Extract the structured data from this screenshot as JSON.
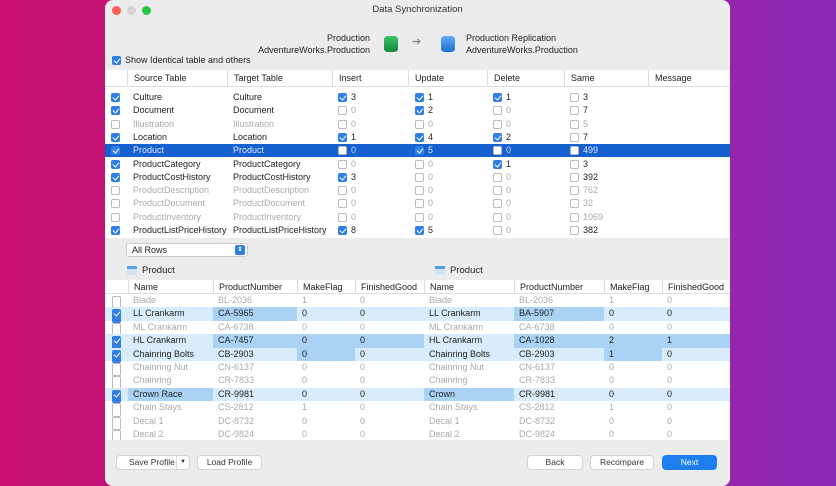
{
  "window": {
    "title": "Data Synchronization"
  },
  "source": {
    "name": "Production",
    "db": "AdventureWorks.Production",
    "color": "#1f9e4a"
  },
  "target": {
    "name": "Production Replication",
    "db": "AdventureWorks.Production",
    "color": "#2b86e0"
  },
  "show_identical": {
    "label": "Show Identical table and others",
    "checked": true
  },
  "top_table": {
    "columns": [
      "Source Table",
      "Target Table",
      "Insert",
      "Update",
      "Delete",
      "Same",
      "Message"
    ],
    "rows": [
      {
        "checked": true,
        "source": "Culture",
        "target": "Culture",
        "insert": [
          true,
          "3"
        ],
        "update": [
          true,
          "1"
        ],
        "delete": [
          true,
          "1"
        ],
        "same": [
          false,
          "3"
        ]
      },
      {
        "checked": true,
        "source": "Document",
        "target": "Document",
        "insert": [
          false,
          "0"
        ],
        "update": [
          true,
          "2"
        ],
        "delete": [
          false,
          "0"
        ],
        "same": [
          false,
          "7"
        ]
      },
      {
        "checked": false,
        "source": "Illustration",
        "target": "Illustration",
        "insert": [
          false,
          "0"
        ],
        "update": [
          false,
          "0"
        ],
        "delete": [
          false,
          "0"
        ],
        "same": [
          false,
          "5"
        ]
      },
      {
        "checked": true,
        "source": "Location",
        "target": "Location",
        "insert": [
          true,
          "1"
        ],
        "update": [
          true,
          "4"
        ],
        "delete": [
          true,
          "2"
        ],
        "same": [
          false,
          "7"
        ]
      },
      {
        "checked": true,
        "selected": true,
        "source": "Product",
        "target": "Product",
        "insert": [
          false,
          "0"
        ],
        "update": [
          true,
          "5"
        ],
        "delete": [
          false,
          "0"
        ],
        "same": [
          false,
          "499"
        ]
      },
      {
        "checked": true,
        "source": "ProductCategory",
        "target": "ProductCategory",
        "insert": [
          false,
          "0"
        ],
        "update": [
          false,
          "0"
        ],
        "delete": [
          true,
          "1"
        ],
        "same": [
          false,
          "3"
        ]
      },
      {
        "checked": true,
        "source": "ProductCostHistory",
        "target": "ProductCostHistory",
        "insert": [
          true,
          "3"
        ],
        "update": [
          false,
          "0"
        ],
        "delete": [
          false,
          "0"
        ],
        "same": [
          false,
          "392"
        ]
      },
      {
        "checked": false,
        "source": "ProductDescription",
        "target": "ProductDescription",
        "insert": [
          false,
          "0"
        ],
        "update": [
          false,
          "0"
        ],
        "delete": [
          false,
          "0"
        ],
        "same": [
          false,
          "762"
        ]
      },
      {
        "checked": false,
        "source": "ProductDocument",
        "target": "ProductDocument",
        "insert": [
          false,
          "0"
        ],
        "update": [
          false,
          "0"
        ],
        "delete": [
          false,
          "0"
        ],
        "same": [
          false,
          "32"
        ]
      },
      {
        "checked": false,
        "source": "ProductInventory",
        "target": "ProductInventory",
        "insert": [
          false,
          "0"
        ],
        "update": [
          false,
          "0"
        ],
        "delete": [
          false,
          "0"
        ],
        "same": [
          false,
          "1069"
        ]
      },
      {
        "checked": true,
        "source": "ProductListPriceHistory",
        "target": "ProductListPriceHistory",
        "insert": [
          true,
          "8"
        ],
        "update": [
          true,
          "5"
        ],
        "delete": [
          false,
          "0"
        ],
        "same": [
          false,
          "382"
        ]
      }
    ]
  },
  "filter": {
    "value": "All Rows"
  },
  "detail": {
    "left_title": "Product",
    "right_title": "Product",
    "columns": [
      "Name",
      "ProductNumber",
      "MakeFlag",
      "FinishedGood"
    ],
    "rows": [
      {
        "checked": false,
        "diff": false,
        "left": [
          "Blade",
          "BL-2036",
          "1",
          "0"
        ],
        "right": [
          "Blade",
          "BL-2036",
          "1",
          "0"
        ],
        "dl": [],
        "dr": []
      },
      {
        "checked": true,
        "diff": true,
        "left": [
          "LL Crankarm",
          "CA-5965",
          "0",
          "0"
        ],
        "right": [
          "LL Crankarm",
          "BA-5907",
          "0",
          "0"
        ],
        "dl": [
          1
        ],
        "dr": [
          1
        ]
      },
      {
        "checked": false,
        "diff": false,
        "left": [
          "ML Crankarm",
          "CA-6738",
          "0",
          "0"
        ],
        "right": [
          "ML Crankarm",
          "CA-6738",
          "0",
          "0"
        ],
        "dl": [],
        "dr": []
      },
      {
        "checked": true,
        "diff": true,
        "left": [
          "HL Crankarm",
          "CA-7457",
          "0",
          "0"
        ],
        "right": [
          "HL Crankarm",
          "CA-1028",
          "2",
          "1"
        ],
        "dl": [
          1,
          2,
          3
        ],
        "dr": [
          1,
          2,
          3
        ]
      },
      {
        "checked": true,
        "diff": true,
        "left": [
          "Chainring Bolts",
          "CB-2903",
          "0",
          "0"
        ],
        "right": [
          "Chainring Bolts",
          "CB-2903",
          "1",
          "0"
        ],
        "dl": [
          2
        ],
        "dr": [
          2
        ]
      },
      {
        "checked": false,
        "diff": false,
        "left": [
          "Chainring Nut",
          "CN-6137",
          "0",
          "0"
        ],
        "right": [
          "Chainring Nut",
          "CN-6137",
          "0",
          "0"
        ],
        "dl": [],
        "dr": []
      },
      {
        "checked": false,
        "diff": false,
        "left": [
          "Chainring",
          "CR-7833",
          "0",
          "0"
        ],
        "right": [
          "Chainring",
          "CR-7833",
          "0",
          "0"
        ],
        "dl": [],
        "dr": []
      },
      {
        "checked": true,
        "diff": true,
        "left": [
          "Crown Race",
          "CR-9981",
          "0",
          "0"
        ],
        "right": [
          "Crown",
          "CR-9981",
          "0",
          "0"
        ],
        "dl": [
          0
        ],
        "dr": [
          0
        ]
      },
      {
        "checked": false,
        "diff": false,
        "left": [
          "Chain Stays",
          "CS-2812",
          "1",
          "0"
        ],
        "right": [
          "Chain Stays",
          "CS-2812",
          "1",
          "0"
        ],
        "dl": [],
        "dr": []
      },
      {
        "checked": false,
        "diff": false,
        "left": [
          "Decal 1",
          "DC-8732",
          "0",
          "0"
        ],
        "right": [
          "Decal 1",
          "DC-8732",
          "0",
          "0"
        ],
        "dl": [],
        "dr": []
      },
      {
        "checked": false,
        "diff": false,
        "left": [
          "Decal 2",
          "DC-9824",
          "0",
          "0"
        ],
        "right": [
          "Decal 2",
          "DC-9824",
          "0",
          "0"
        ],
        "dl": [],
        "dr": []
      }
    ]
  },
  "footer": {
    "save_profile": "Save Profile",
    "load_profile": "Load Profile",
    "back": "Back",
    "recompare": "Recompare",
    "next": "Next"
  }
}
